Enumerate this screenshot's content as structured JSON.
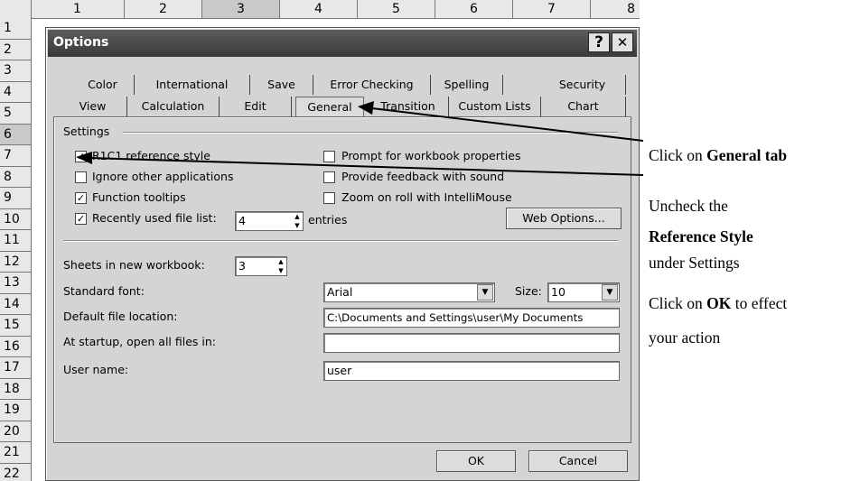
{
  "sheet": {
    "columns": [
      "1",
      "2",
      "3",
      "4",
      "5",
      "6",
      "7",
      "8"
    ],
    "rows": [
      "1",
      "2",
      "3",
      "4",
      "5",
      "6",
      "7",
      "8",
      "9",
      "10",
      "11",
      "12",
      "13",
      "14",
      "15",
      "16",
      "17",
      "18",
      "19",
      "20",
      "21",
      "22"
    ]
  },
  "dialog": {
    "title": "Options",
    "help_label": "?",
    "close_label": "✕",
    "tabs_row1": [
      "Color",
      "International",
      "Save",
      "Error Checking",
      "Spelling",
      "Security"
    ],
    "tabs_row2": [
      "View",
      "Calculation",
      "Edit",
      "General",
      "Transition",
      "Custom Lists",
      "Chart"
    ],
    "active_tab": "General",
    "settings_heading": "Settings",
    "checkboxes_left": [
      {
        "label": "R1C1 reference style",
        "checked": true
      },
      {
        "label": "Ignore other applications",
        "checked": false
      },
      {
        "label": "Function tooltips",
        "checked": true
      },
      {
        "label": "Recently used file list:",
        "checked": true
      }
    ],
    "checkboxes_right": [
      {
        "label": "Prompt for workbook properties",
        "checked": false
      },
      {
        "label": "Provide feedback with sound",
        "checked": false
      },
      {
        "label": "Zoom on roll with IntelliMouse",
        "checked": false
      }
    ],
    "recent_files_value": "4",
    "entries_label": "entries",
    "web_options_label": "Web Options...",
    "sheets_label": "Sheets in new workbook:",
    "sheets_value": "3",
    "standard_font_label": "Standard font:",
    "standard_font_value": "Arial",
    "size_label": "Size:",
    "size_value": "10",
    "default_location_label": "Default file location:",
    "default_location_value": "C:\\Documents and Settings\\user\\My Documents",
    "startup_label": "At startup, open all files in:",
    "startup_value": "",
    "username_label": "User name:",
    "username_value": "user",
    "ok_label": "OK",
    "cancel_label": "Cancel"
  },
  "annotations": {
    "general_pre": "Click on ",
    "general_bold": "General tab",
    "uncheck_line1": "Uncheck the",
    "uncheck_bold": "Reference Style",
    "uncheck_line3": "under Settings",
    "ok_pre": "Click on ",
    "ok_bold": "OK",
    "ok_post": " to effect",
    "ok_line2": "your action"
  }
}
